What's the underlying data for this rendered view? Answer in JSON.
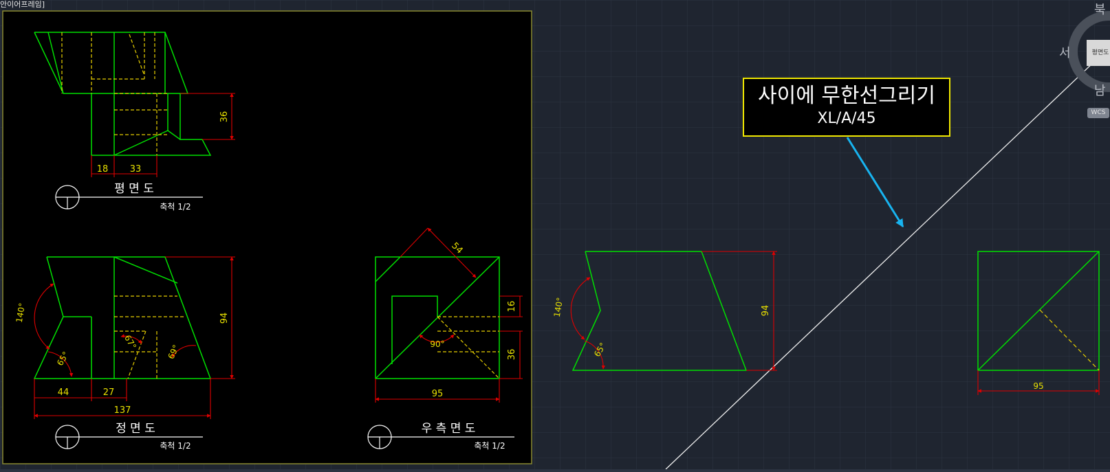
{
  "viewport_label": "안이어프레임]",
  "callout": {
    "title": "사이에 무한선그리기",
    "command": "XL/A/45"
  },
  "viewcube": {
    "north": "북",
    "west": "서",
    "south": "남",
    "face": "평면도",
    "wcs": "WCS"
  },
  "views": {
    "plan": {
      "title": "평 면 도",
      "scale": "축척 1/2",
      "dims": [
        "36",
        "18",
        "33"
      ]
    },
    "front": {
      "title": "정 면 도",
      "scale": "축척 1/2",
      "dims": [
        "94",
        "44",
        "27",
        "137"
      ],
      "angles": [
        "140°",
        "65°",
        "67°",
        "69°"
      ]
    },
    "right": {
      "title": "우 측 면 도",
      "scale": "축척 1/2",
      "dims": [
        "54",
        "16",
        "36",
        "95"
      ],
      "angles": [
        "90°"
      ]
    }
  },
  "work": {
    "dims": [
      "94",
      "95"
    ],
    "angles": [
      "140°",
      "65°"
    ]
  },
  "colors": {
    "geometry": "#00e000",
    "hidden": "#e8d000",
    "dimension": "#e00000",
    "dimtext": "#e8e000",
    "callout_border": "#f0e800",
    "arrow": "#18b4f0"
  }
}
